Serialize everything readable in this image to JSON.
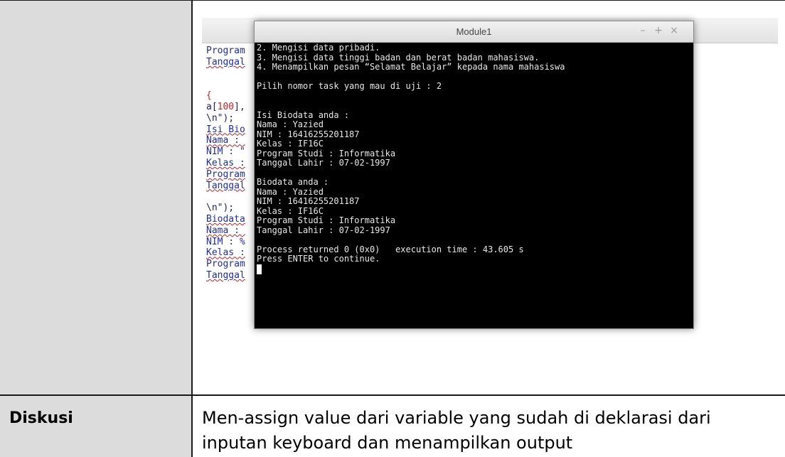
{
  "editor": {
    "lines": [
      {
        "text": "Program",
        "tone": "blue",
        "underline": false
      },
      {
        "text": "Tanggal",
        "tone": "blue",
        "underline": true
      },
      {
        "text": "",
        "tone": "blue",
        "underline": false
      },
      {
        "text": "",
        "tone": "blue",
        "underline": false
      },
      {
        "text": "{",
        "tone": "red",
        "underline": false
      },
      {
        "text": "a[100],",
        "tone": "mixed-a",
        "underline": false
      },
      {
        "text": "\\n\");",
        "tone": "navy",
        "underline": false
      },
      {
        "text": "Isi Bio",
        "tone": "blue",
        "underline": true
      },
      {
        "text": "Nama : ",
        "tone": "blue",
        "underline": true
      },
      {
        "text": "NIM : \"",
        "tone": "blue",
        "underline": false
      },
      {
        "text": "Kelas :",
        "tone": "blue",
        "underline": true
      },
      {
        "text": "Program",
        "tone": "blue",
        "underline": true
      },
      {
        "text": "Tanggal",
        "tone": "blue",
        "underline": true
      },
      {
        "text": "",
        "tone": "blue",
        "underline": false
      },
      {
        "text": "\\n\");",
        "tone": "navy",
        "underline": false
      },
      {
        "text": "Biodata",
        "tone": "blue",
        "underline": true
      },
      {
        "text": "Nama : ",
        "tone": "blue",
        "underline": true
      },
      {
        "text": "NIM : %",
        "tone": "blue",
        "underline": false
      },
      {
        "text": "Kelas :",
        "tone": "blue",
        "underline": true
      },
      {
        "text": "Program",
        "tone": "blue",
        "underline": false
      },
      {
        "text": "Tanggal",
        "tone": "blue",
        "underline": true
      }
    ]
  },
  "terminal": {
    "title": "Module1",
    "controls": {
      "minimize": "–",
      "maximize": "+",
      "close": "×"
    },
    "lines": [
      "2. Mengisi data pribadi.",
      "3. Mengisi data tinggi badan dan berat badan mahasiswa.",
      "4. Menampilkan pesan “Selamat Belajar” kepada nama mahasiswa",
      "",
      "Pilih nomor task yang mau di uji : 2",
      "",
      "",
      "Isi Biodata anda :",
      "Nama : Yazied",
      "NIM : 16416255201187",
      "Kelas : IF16C",
      "Program Studi : Informatika",
      "Tanggal Lahir : 07-02-1997",
      "",
      "Biodata anda :",
      "Nama : Yazied",
      "NIM : 16416255201187",
      "Kelas : IF16C",
      "Program Studi : Informatika",
      "Tanggal Lahir : 07-02-1997",
      "",
      "Process returned 0 (0x0)   execution time : 43.605 s",
      "Press ENTER to continue."
    ]
  },
  "diskusi": {
    "label": "Diskusi",
    "text": "Men-assign value dari variable yang sudah di deklarasi dari inputan keyboard dan menampilkan output"
  },
  "colors": {
    "cell_gray": "#dcdcdc",
    "border": "#1a1a1a",
    "terminal_bg": "#000000",
    "terminal_fg": "#e8e8e8",
    "code_blue": "#1c2bb4",
    "code_red": "#d02020"
  }
}
